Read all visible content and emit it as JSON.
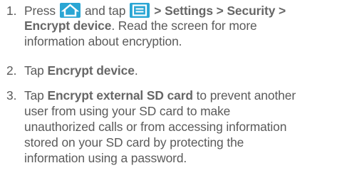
{
  "steps": [
    {
      "number": "1.",
      "press": "Press",
      "and_tap": "and tap",
      "path_sep1": ">",
      "settings": "Settings",
      "path_sep2": ">",
      "security": "Security",
      "path_sep3": ">",
      "encrypt_device": "Encrypt device",
      "line2_rest": ". Read the screen for more",
      "line3": "information about encryption.",
      "icons": [
        "home-icon",
        "menu-icon"
      ]
    },
    {
      "number": "2.",
      "tap": "Tap",
      "encrypt_device": "Encrypt device",
      "period": "."
    },
    {
      "number": "3.",
      "tap": "Tap",
      "encrypt_sd": "Encrypt external SD card",
      "line1_rest": "to prevent another",
      "line2": "user from using your SD card to make",
      "line3": "unauthorized calls or from accessing information",
      "line4": "stored on your SD card by protecting the",
      "line5": "information using a password."
    }
  ],
  "colors": {
    "text": "#5a5a5a",
    "icon_bg": "#2aa6d4",
    "icon_fg": "#ffffff"
  }
}
